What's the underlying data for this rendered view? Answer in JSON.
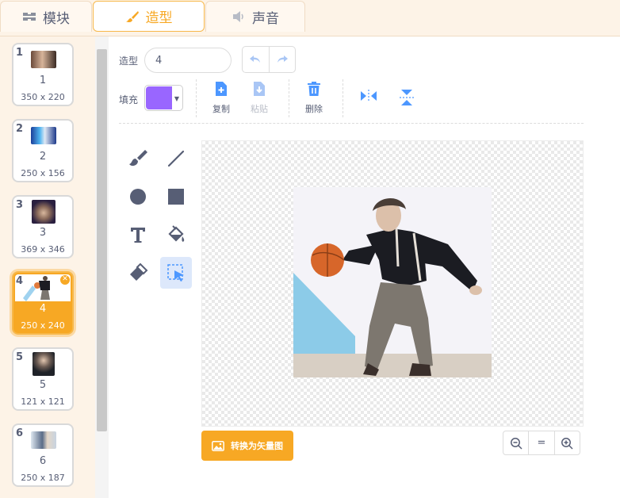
{
  "tabs": [
    {
      "label": "模块",
      "icon": "blocks-icon",
      "active": false
    },
    {
      "label": "造型",
      "icon": "paintbrush-icon",
      "active": true
    },
    {
      "label": "声音",
      "icon": "speaker-icon",
      "active": false
    }
  ],
  "costumes": [
    {
      "number": "1",
      "name": "1",
      "size": "350 x 220",
      "selected": false
    },
    {
      "number": "2",
      "name": "2",
      "size": "250 x 156",
      "selected": false
    },
    {
      "number": "3",
      "name": "3",
      "size": "369 x 346",
      "selected": false
    },
    {
      "number": "4",
      "name": "4",
      "size": "250 x 240",
      "selected": true
    },
    {
      "number": "5",
      "name": "5",
      "size": "121 x 121",
      "selected": false
    },
    {
      "number": "6",
      "name": "6",
      "size": "250 x 187",
      "selected": false
    }
  ],
  "editor": {
    "costume_label": "造型",
    "costume_name": "4",
    "fill_label": "填充",
    "fill_color": "#9966ff",
    "actions": {
      "copy": "复制",
      "paste": "粘贴",
      "delete": "删除"
    },
    "convert_button": "转换为矢量图",
    "zoom_reset": "="
  },
  "colors": {
    "accent": "#f7a824",
    "toolbar_blue": "#4c97ff"
  }
}
